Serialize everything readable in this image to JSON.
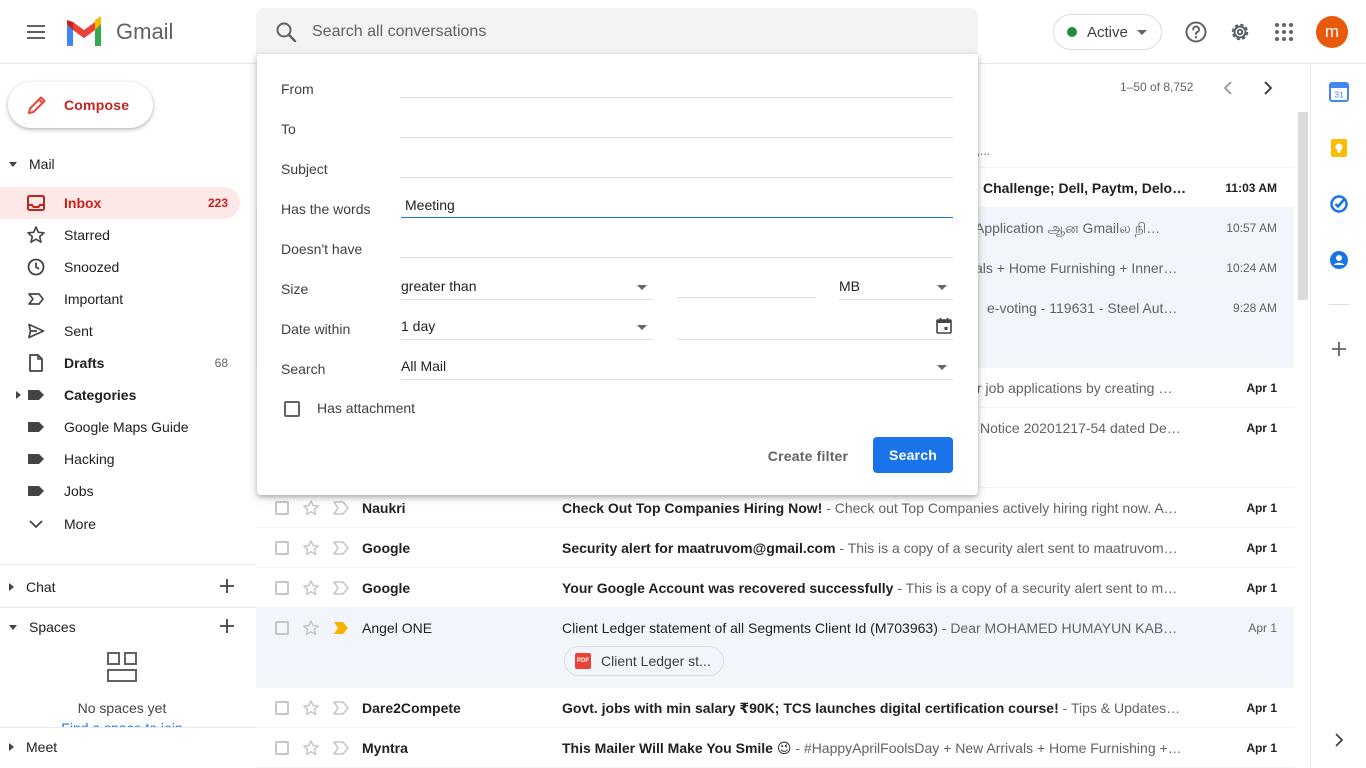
{
  "header": {
    "product_name": "Gmail",
    "search_placeholder": "Search all conversations",
    "status_label": "Active",
    "avatar_letter": "m",
    "colors": {
      "status_dot": "#1e8e3e",
      "avatar_bg": "#e8590c",
      "accent": "#1a73e8",
      "inbox_red": "#c5221f"
    }
  },
  "sidebar": {
    "compose_label": "Compose",
    "mail_section": "Mail",
    "items": [
      {
        "label": "Inbox",
        "count": "223",
        "icon": "inbox-icon"
      },
      {
        "label": "Starred",
        "count": "",
        "icon": "star-icon"
      },
      {
        "label": "Snoozed",
        "count": "",
        "icon": "clock-icon"
      },
      {
        "label": "Important",
        "count": "",
        "icon": "important-icon"
      },
      {
        "label": "Sent",
        "count": "",
        "icon": "send-icon"
      },
      {
        "label": "Drafts",
        "count": "68",
        "icon": "draft-icon"
      },
      {
        "label": "Categories",
        "count": "",
        "icon": "label-icon"
      },
      {
        "label": "Google Maps Guide",
        "count": "",
        "icon": "label-icon"
      },
      {
        "label": "Hacking",
        "count": "",
        "icon": "label-icon"
      },
      {
        "label": "Jobs",
        "count": "",
        "icon": "label-icon"
      },
      {
        "label": "More",
        "count": "",
        "icon": "chevron-down-icon"
      }
    ],
    "chat_section": "Chat",
    "spaces_section": "Spaces",
    "spaces_empty": "No spaces yet",
    "spaces_link": "Find a space to join",
    "meet_section": "Meet"
  },
  "mail_list": {
    "pagination": "1–50 of 8,752",
    "partial_rows": [
      {
        "text": "e,...",
        "date": ""
      },
      {
        "text": "Challenge; Dell, Paytm, Deloit…",
        "date": "11:03 AM",
        "unread": true
      },
      {
        "text": "Application ஆன Gmailல நி…",
        "date": "10:57 AM",
        "unread": false
      },
      {
        "text": "als + Home Furnishing + Inner…",
        "date": "10:24 AM",
        "unread": false
      },
      {
        "text": "e-voting - 119631 - Steel Aut…",
        "date": "9:28 AM",
        "unread": false
      },
      {
        "text": "r job applications by creating …",
        "date": "Apr 1",
        "unread": true
      },
      {
        "text": "Notice 20201217-54 dated De…",
        "date": "Apr 1",
        "unread": true
      }
    ],
    "rows": [
      {
        "sender": "Naukri",
        "subject": "Check Out Top Companies Hiring Now!",
        "snippet": " - Check out Top Companies actively hiring right now. Ap…",
        "date": "Apr 1",
        "unread": true,
        "important": false
      },
      {
        "sender": "Google",
        "subject": "Security alert for maatruvom@gmail.com",
        "snippet": " - This is a copy of a security alert sent to maatruvom…",
        "date": "Apr 1",
        "unread": true,
        "important": false
      },
      {
        "sender": "Google",
        "subject": "Your Google Account was recovered successfully",
        "snippet": " - This is a copy of a security alert sent to ma…",
        "date": "Apr 1",
        "unread": true,
        "important": false
      },
      {
        "sender": "Angel ONE",
        "subject": "Client Ledger statement of all Segments Client Id (M703963)",
        "snippet": " - Dear MOHAMED HUMAYUN KAB…",
        "date": "Apr 1",
        "unread": false,
        "important": true,
        "attachment": "Client Ledger st..."
      },
      {
        "sender": "Dare2Compete",
        "subject": "Govt. jobs with min salary ₹90K; TCS launches digital certification course!",
        "snippet": " - Tips & Updates NT…",
        "date": "Apr 1",
        "unread": true,
        "important": false
      },
      {
        "sender": "Myntra",
        "subject": "This Mailer Will Make You Smile 😉",
        "snippet": " - #HappyAprilFoolsDay + New Arrivals + Home Furnishing +…",
        "date": "Apr 1",
        "unread": true,
        "important": false
      }
    ]
  },
  "advanced_search": {
    "from_label": "From",
    "to_label": "To",
    "subject_label": "Subject",
    "has_words_label": "Has the words",
    "has_words_value": "Meeting",
    "doesnt_have_label": "Doesn't have",
    "size_label": "Size",
    "size_operator": "greater than",
    "size_unit": "MB",
    "date_label": "Date within",
    "date_value": "1 day",
    "search_label": "Search",
    "search_scope": "All Mail",
    "attachment_label": "Has attachment",
    "create_filter": "Create filter",
    "search_button": "Search"
  }
}
